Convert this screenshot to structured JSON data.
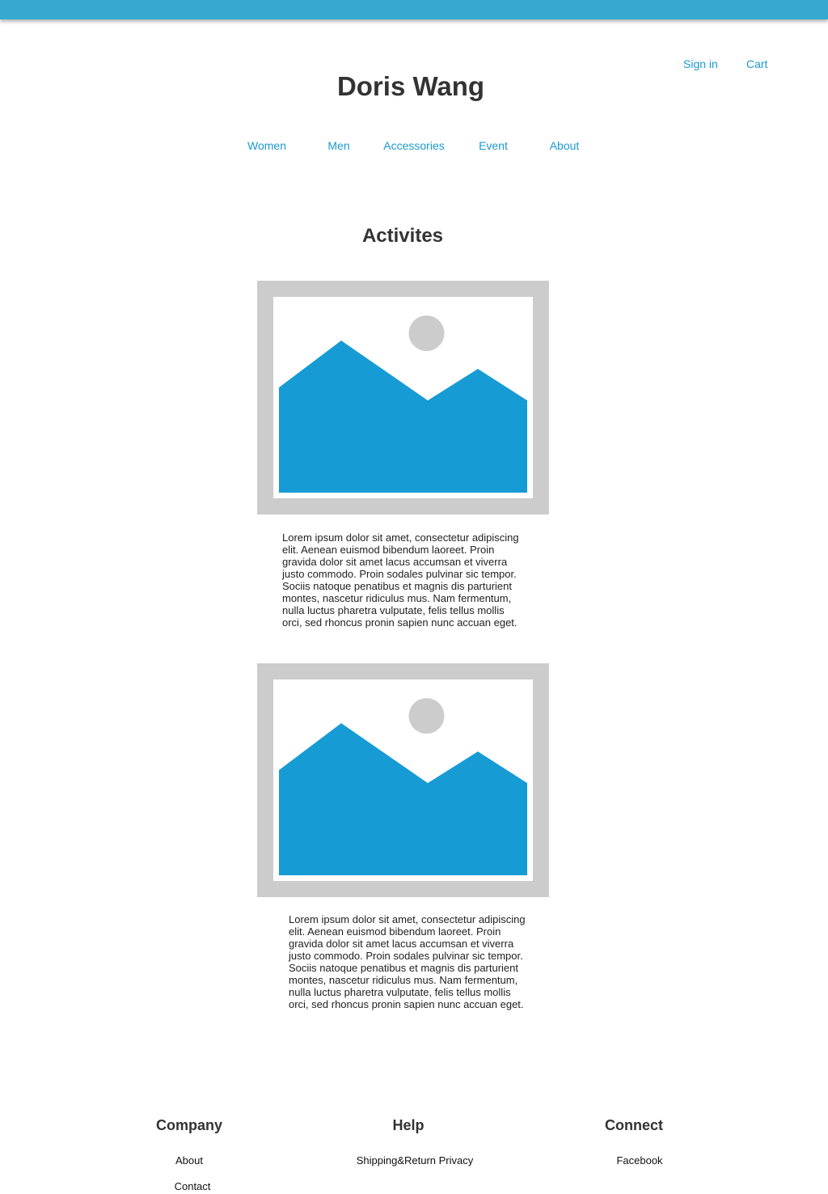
{
  "header": {
    "sign_in": "Sign in",
    "cart": "Cart",
    "site_title": "Doris Wang"
  },
  "nav": {
    "items": [
      "Women",
      "Men",
      "Accessories",
      "Event",
      "About"
    ]
  },
  "activities": {
    "title": "Activites",
    "cards": [
      {
        "image_icon": "image-placeholder-icon",
        "text": "Lorem ipsum dolor sit amet, consectetur adipiscing elit. Aenean euismod bibendum laoreet. Proin gravida dolor sit amet lacus accumsan et viverra justo commodo. Proin sodales pulvinar sic tempor. Sociis natoque penatibus et magnis dis parturient montes, nascetur ridiculus mus. Nam fermentum, nulla luctus pharetra vulputate, felis tellus mollis orci, sed rhoncus pronin sapien nunc accuan eget."
      },
      {
        "image_icon": "image-placeholder-icon",
        "text": "Lorem ipsum dolor sit amet, consectetur adipiscing elit. Aenean euismod bibendum laoreet. Proin gravida dolor sit amet lacus accumsan et viverra justo commodo. Proin sodales pulvinar sic tempor. Sociis natoque penatibus et magnis dis parturient montes, nascetur ridiculus mus. Nam fermentum, nulla luctus pharetra vulputate, felis tellus mollis orci, sed rhoncus pronin sapien nunc accuan eget."
      }
    ]
  },
  "footer": {
    "company": {
      "heading": "Company",
      "links": [
        "About",
        "Contact"
      ]
    },
    "help": {
      "heading": "Help",
      "links": [
        "Shipping&Return Privacy"
      ]
    },
    "connect": {
      "heading": "Connect",
      "links": [
        "Facebook"
      ]
    }
  },
  "colors": {
    "top_bar": "#35a9cf",
    "link": "#1a99d2",
    "heading": "#333333",
    "placeholder_frame": "#cccccc",
    "placeholder_mountain": "#179bd4"
  }
}
